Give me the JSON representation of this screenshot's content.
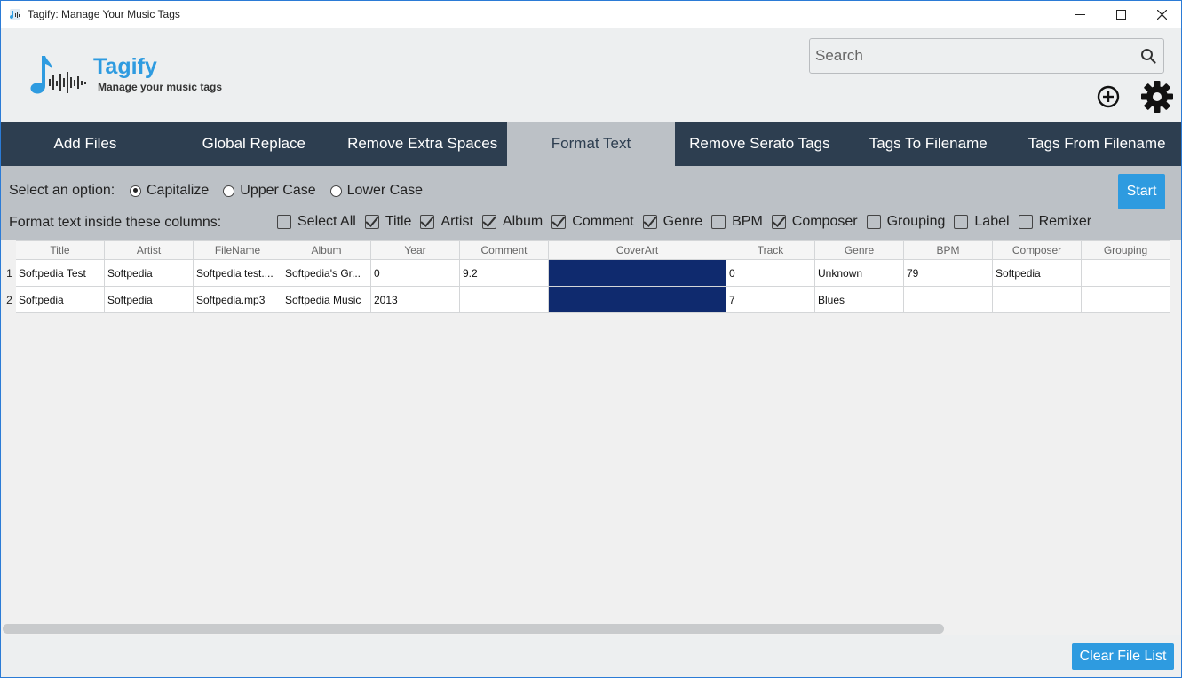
{
  "window": {
    "title": "Tagify: Manage Your Music Tags",
    "controls": {
      "minimize": "—",
      "maximize": "☐",
      "close": "✕"
    }
  },
  "header": {
    "logo_name": "Tagify",
    "logo_tagline": "Manage your music tags",
    "search_placeholder": "Search",
    "search_value": ""
  },
  "nav": {
    "active_index": 3,
    "tabs": [
      {
        "label": "Add Files"
      },
      {
        "label": "Global Replace"
      },
      {
        "label": "Remove Extra Spaces"
      },
      {
        "label": "Format Text"
      },
      {
        "label": "Remove Serato Tags"
      },
      {
        "label": "Tags To Filename"
      },
      {
        "label": "Tags From Filename"
      }
    ]
  },
  "options": {
    "select_label": "Select an option:",
    "radios": [
      {
        "label": "Capitalize",
        "selected": true
      },
      {
        "label": "Upper Case",
        "selected": false
      },
      {
        "label": "Lower Case",
        "selected": false
      }
    ],
    "columns_label": "Format text inside these columns:",
    "checkboxes": [
      {
        "label": "Select All",
        "checked": false
      },
      {
        "label": "Title",
        "checked": true
      },
      {
        "label": "Artist",
        "checked": true
      },
      {
        "label": "Album",
        "checked": true
      },
      {
        "label": "Comment",
        "checked": true
      },
      {
        "label": "Genre",
        "checked": true
      },
      {
        "label": "BPM",
        "checked": false
      },
      {
        "label": "Composer",
        "checked": true
      },
      {
        "label": "Grouping",
        "checked": false
      },
      {
        "label": "Label",
        "checked": false
      },
      {
        "label": "Remixer",
        "checked": false
      }
    ],
    "start_label": "Start"
  },
  "table": {
    "columns": [
      "Title",
      "Artist",
      "FileName",
      "Album",
      "Year",
      "Comment",
      "CoverArt",
      "Track",
      "Genre",
      "BPM",
      "Composer",
      "Grouping"
    ],
    "rows": [
      {
        "index": "1",
        "cells": [
          "Softpedia Test",
          "Softpedia",
          "Softpedia test....",
          "Softpedia's Gr...",
          "0",
          "9.2",
          "",
          "0",
          "Unknown",
          "79",
          "Softpedia",
          ""
        ]
      },
      {
        "index": "2",
        "cells": [
          "Softpedia",
          "Softpedia",
          "Softpedia.mp3",
          "Softpedia Music",
          "2013",
          "",
          "",
          "7",
          "Blues",
          "",
          "",
          ""
        ]
      }
    ],
    "cover_color": "#0f2a6e"
  },
  "footer": {
    "clear_label": "Clear File List"
  },
  "colors": {
    "accent": "#2e9be0",
    "nav_bg": "#2d3e50",
    "panel_bg": "#bcc1c6"
  },
  "icons": {
    "app": "music-note-icon",
    "search": "search-icon",
    "add": "plus-circle-icon",
    "settings": "gear-icon"
  }
}
